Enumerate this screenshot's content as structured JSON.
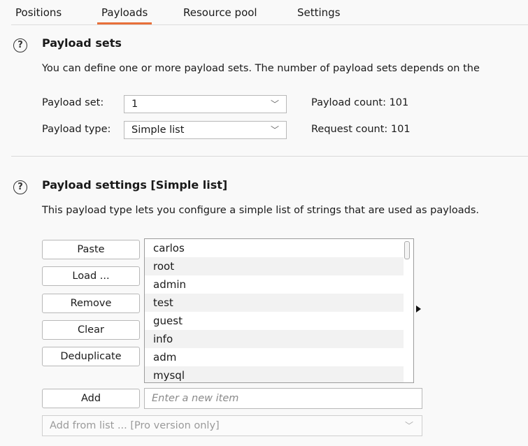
{
  "tabs": [
    {
      "label": "Positions"
    },
    {
      "label": "Payloads",
      "active": true
    },
    {
      "label": "Resource pool"
    },
    {
      "label": "Settings"
    }
  ],
  "payload_sets": {
    "title": "Payload sets",
    "description": "You can define one or more payload sets. The number of payload sets depends on the",
    "set_label": "Payload set:",
    "set_value": "1",
    "type_label": "Payload type:",
    "type_value": "Simple list",
    "payload_count_label": "Payload count:",
    "payload_count": "101",
    "request_count_label": "Request count:",
    "request_count": "101"
  },
  "payload_settings": {
    "title": "Payload settings [Simple list]",
    "description": "This payload type lets you configure a simple list of strings that are used as payloads.",
    "buttons": {
      "paste": "Paste",
      "load": "Load ...",
      "remove": "Remove",
      "clear": "Clear",
      "deduplicate": "Deduplicate",
      "add": "Add"
    },
    "list_items": [
      "carlos",
      "root",
      "admin",
      "test",
      "guest",
      "info",
      "adm",
      "mysql"
    ],
    "add_placeholder": "Enter a new item",
    "add_from_list": "Add from list ... [Pro version only]"
  },
  "colors": {
    "accent": "#e8703a"
  },
  "icons": {
    "help": "?",
    "chevron": "﹀"
  }
}
